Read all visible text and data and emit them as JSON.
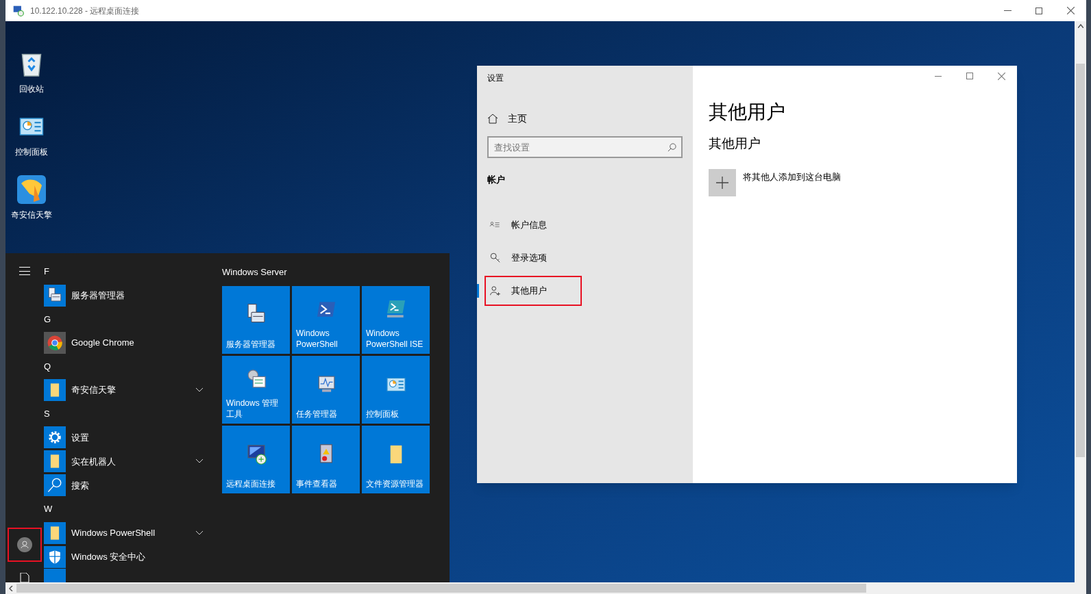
{
  "rdp_window": {
    "title": "10.122.10.228 - 远程桌面连接"
  },
  "desktop_icons": [
    {
      "kind": "recycle",
      "label": "回收站"
    },
    {
      "kind": "control",
      "label": "控制面板"
    },
    {
      "kind": "shield-app",
      "label": "奇安信天擎"
    }
  ],
  "start_menu": {
    "user_highlighted": true,
    "groups": [
      {
        "letter": "F",
        "apps": [
          {
            "label": "服务器管理器",
            "kind": "server",
            "expandable": false
          }
        ]
      },
      {
        "letter": "G",
        "apps": [
          {
            "label": "Google Chrome",
            "kind": "chrome",
            "expandable": false
          }
        ]
      },
      {
        "letter": "Q",
        "apps": [
          {
            "label": "奇安信天擎",
            "kind": "folder",
            "expandable": true
          }
        ]
      },
      {
        "letter": "S",
        "apps": [
          {
            "label": "设置",
            "kind": "gear",
            "expandable": false
          },
          {
            "label": "实在机器人",
            "kind": "folder",
            "expandable": true
          },
          {
            "label": "搜索",
            "kind": "search",
            "expandable": false
          }
        ]
      },
      {
        "letter": "W",
        "apps": [
          {
            "label": "Windows PowerShell",
            "kind": "folder",
            "expandable": true
          },
          {
            "label": "Windows 安全中心",
            "kind": "shield",
            "expandable": false
          }
        ]
      }
    ],
    "tiles_title": "Windows Server",
    "tiles": [
      {
        "label": "服务器管理器",
        "kind": "server"
      },
      {
        "label": "Windows PowerShell",
        "kind": "ps"
      },
      {
        "label": "Windows PowerShell ISE",
        "kind": "ps-ise"
      },
      {
        "label": "Windows 管理工具",
        "kind": "tools"
      },
      {
        "label": "任务管理器",
        "kind": "monitor"
      },
      {
        "label": "控制面板",
        "kind": "control"
      },
      {
        "label": "远程桌面连接",
        "kind": "rdp"
      },
      {
        "label": "事件查看器",
        "kind": "log"
      },
      {
        "label": "文件资源管理器",
        "kind": "folder"
      }
    ]
  },
  "settings": {
    "title": "设置",
    "home": "主页",
    "search": {
      "placeholder": "查找设置"
    },
    "section": "帐户",
    "nav": [
      {
        "label": "帐户信息",
        "kind": "info",
        "selected": false,
        "highlighted": false
      },
      {
        "label": "登录选项",
        "kind": "key",
        "selected": false,
        "highlighted": false
      },
      {
        "label": "其他用户",
        "kind": "user-add",
        "selected": true,
        "highlighted": true
      }
    ],
    "page_title": "其他用户",
    "subheading": "其他用户",
    "add_action": "将其他人添加到这台电脑"
  }
}
